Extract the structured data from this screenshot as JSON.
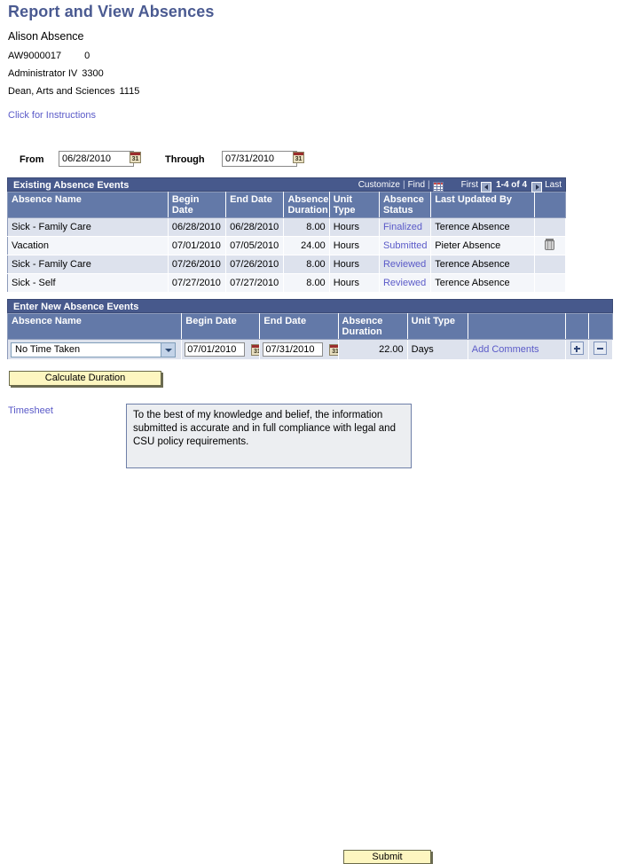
{
  "header": {
    "title": "Report and View Absences",
    "employee_name": "Alison Absence",
    "employee_id": "AW9000017",
    "employee_record": "0",
    "job_title": "Administrator IV",
    "job_code": "3300",
    "department": "Dean, Arts and Sciences",
    "department_code": "1115",
    "instructions_link": "Click for Instructions"
  },
  "date_range": {
    "from_label": "From",
    "from_value": "06/28/2010",
    "through_label": "Through",
    "through_value": "07/31/2010",
    "calendar_icon_label": "31"
  },
  "existing_grid": {
    "title": "Existing Absence Events",
    "toolbar": {
      "customize": "Customize",
      "separator": "|",
      "find": "Find",
      "grid_icon": "spreadsheet-download-icon",
      "first": "First",
      "prev_icon": "previous-arrow-icon",
      "counter": "1-4 of 4",
      "next_icon": "next-arrow-icon",
      "last": "Last"
    },
    "columns": [
      "Absence Name",
      "Begin Date",
      "End Date",
      "Absence Duration",
      "Unit Type",
      "Absence Status",
      "Last Updated By",
      ""
    ],
    "rows": [
      {
        "absence_name": "Sick - Family Care",
        "begin_date": "06/28/2010",
        "end_date": "06/28/2010",
        "duration": "8.00",
        "unit_type": "Hours",
        "status": "Finalized",
        "last_updated_by": "Terence Absence",
        "delete_icon": ""
      },
      {
        "absence_name": "Vacation",
        "begin_date": "07/01/2010",
        "end_date": "07/05/2010",
        "duration": "24.00",
        "unit_type": "Hours",
        "status": "Submitted",
        "last_updated_by": "Pieter Absence",
        "delete_icon": "trash-icon"
      },
      {
        "absence_name": "Sick - Family Care",
        "begin_date": "07/26/2010",
        "end_date": "07/26/2010",
        "duration": "8.00",
        "unit_type": "Hours",
        "status": "Reviewed",
        "last_updated_by": "Terence Absence",
        "delete_icon": ""
      },
      {
        "absence_name": "Sick - Self",
        "begin_date": "07/27/2010",
        "end_date": "07/27/2010",
        "duration": "8.00",
        "unit_type": "Hours",
        "status": "Reviewed",
        "last_updated_by": "Terence Absence",
        "delete_icon": ""
      }
    ]
  },
  "new_grid": {
    "title": "Enter New Absence Events",
    "columns": [
      "Absence Name",
      "Begin Date",
      "End Date",
      "Absence Duration",
      "Unit Type",
      "",
      "",
      ""
    ],
    "row": {
      "absence_name": "No Time Taken",
      "begin_date": "07/01/2010",
      "end_date": "07/31/2010",
      "duration": "22.00",
      "unit_type": "Days",
      "comments_link": "Add Comments",
      "add_row_label": "+",
      "remove_row_label": "-"
    }
  },
  "actions": {
    "calculate_duration": "Calculate Duration",
    "timesheet_link": "Timesheet",
    "attestation": "To the best of my knowledge and belief, the information submitted is accurate and in full compliance with legal and CSU policy requirements.",
    "submit": "Submit"
  },
  "colors": {
    "title_text": "#4a5a91",
    "grid_title_bar": "#47598c",
    "grid_header": "#6379a8",
    "link": "#5a5ac8",
    "button_yellow": "#fdf6c0",
    "row_odd": "#dde2ed",
    "row_even": "#f4f6fa"
  }
}
